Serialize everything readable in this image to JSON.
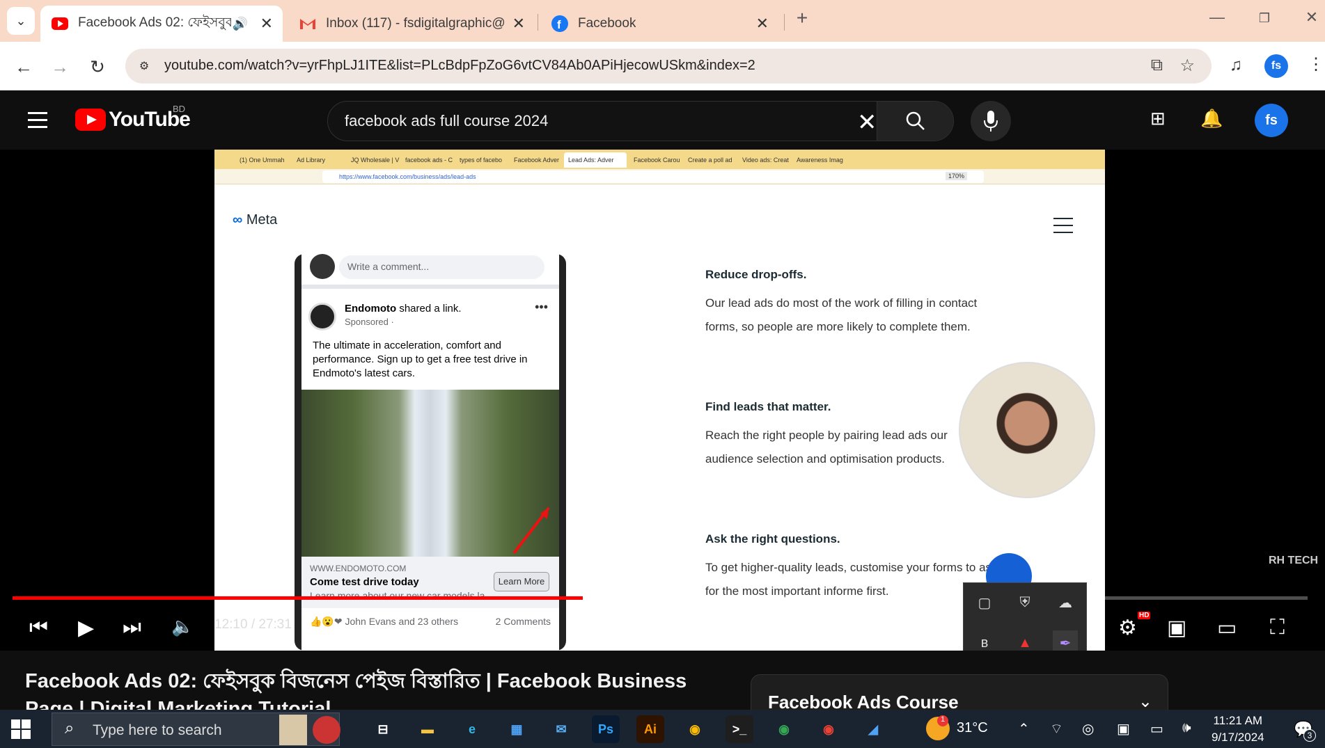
{
  "browser": {
    "tabs": [
      {
        "title": "Facebook Ads 02: ফেইসবুক",
        "icon": "youtube-icon",
        "active": true,
        "audio": true
      },
      {
        "title": "Inbox (117) - fsdigitalgraphic@",
        "icon": "gmail-icon",
        "active": false
      },
      {
        "title": "Facebook",
        "icon": "facebook-icon",
        "active": false
      }
    ],
    "url": "youtube.com/watch?v=yrFhpLJ1ITE&list=PLcBdpFpZoG6vtCV84Ab0APiHjecowUSkm&index=2",
    "profile_initial": "fs"
  },
  "youtube": {
    "logo_text": "YouTube",
    "country": "BD",
    "search_query": "facebook ads full course 2024",
    "avatar_initial": "fs"
  },
  "video_frame": {
    "fx_tabs": [
      "(1) One Ummah",
      "Ad Library",
      "JQ Wholesale | V",
      "facebook ads - C",
      "types of facebo",
      "Facebook Adver",
      "Lead Ads: Adver",
      "Facebook Carou",
      "Create a poll ad",
      "Video ads: Creat",
      "Awareness Imag"
    ],
    "fx_url": "https://www.facebook.com/business/ads/lead-ads",
    "fx_zoom": "170%",
    "meta_logo": "Meta",
    "post": {
      "comment_placeholder": "Write a comment...",
      "author": "Endomoto",
      "author_suffix": " shared a link.",
      "sponsored": "Sponsored · ",
      "text": "The ultimate in acceleration, comfort and performance. Sign up to get a free test drive in Endmoto's latest cars.",
      "domain": "WWW.ENDOMOTO.COM",
      "cta_title": "Come test drive today",
      "cta_desc": "Learn more about our new car models la...",
      "cta_button": "Learn More",
      "reactions": "John Evans and 23 others",
      "comments": "2 Comments"
    },
    "article": {
      "h1": "Reduce drop-offs.",
      "p1": "Our lead ads do most of the work of filling in contact forms, so people are more likely to complete them.",
      "h2": "Find leads that matter.",
      "p2": "Reach the right people by pairing lead ads our audience selection and optimisation products.",
      "h3": "Ask the right questions.",
      "p3": "To get higher-quality leads, customise your forms to ask for the most important informe first."
    },
    "watermark": "RH TECH"
  },
  "player": {
    "time": "12:10 / 27:31",
    "progress": 0.4405,
    "hd_badge": "HD"
  },
  "below": {
    "title": "Facebook Ads 02: ফেইসবুক বিজনেস পেইজ বিস্তারিত | Facebook Business Page | Digital Marketing Tutorial",
    "playlist_title": "Facebook Ads Course"
  },
  "taskbar": {
    "search_placeholder": "Type here to search",
    "weather": "31°C",
    "time": "11:21 AM",
    "date": "9/17/2024",
    "notification_count": "3",
    "apps": [
      {
        "name": "task-view-icon",
        "label": "⊟",
        "bg": "transparent",
        "color": "#fff"
      },
      {
        "name": "file-explorer-icon",
        "label": "▬",
        "bg": "transparent",
        "color": "#f5c542"
      },
      {
        "name": "edge-icon",
        "label": "e",
        "bg": "transparent",
        "color": "#33b5e5"
      },
      {
        "name": "store-icon",
        "label": "▦",
        "bg": "transparent",
        "color": "#4fa3f7"
      },
      {
        "name": "mail-icon",
        "label": "✉",
        "bg": "transparent",
        "color": "#5ab0f5"
      },
      {
        "name": "photoshop-icon",
        "label": "Ps",
        "bg": "#0a1a2f",
        "color": "#31a8ff"
      },
      {
        "name": "illustrator-icon",
        "label": "Ai",
        "bg": "#2e1300",
        "color": "#ff9a00"
      },
      {
        "name": "chrome-icon",
        "label": "◉",
        "bg": "transparent",
        "color": "#fbbc05"
      },
      {
        "name": "terminal-icon",
        "label": ">_",
        "bg": "#1e1e1e",
        "color": "#fff"
      },
      {
        "name": "chrome-profile-icon",
        "label": "◉",
        "bg": "transparent",
        "color": "#34a853"
      },
      {
        "name": "chrome-profile-2-icon",
        "label": "◉",
        "bg": "transparent",
        "color": "#ea4335"
      },
      {
        "name": "paint-icon",
        "label": "◢",
        "bg": "transparent",
        "color": "#4fa3f7"
      }
    ]
  }
}
